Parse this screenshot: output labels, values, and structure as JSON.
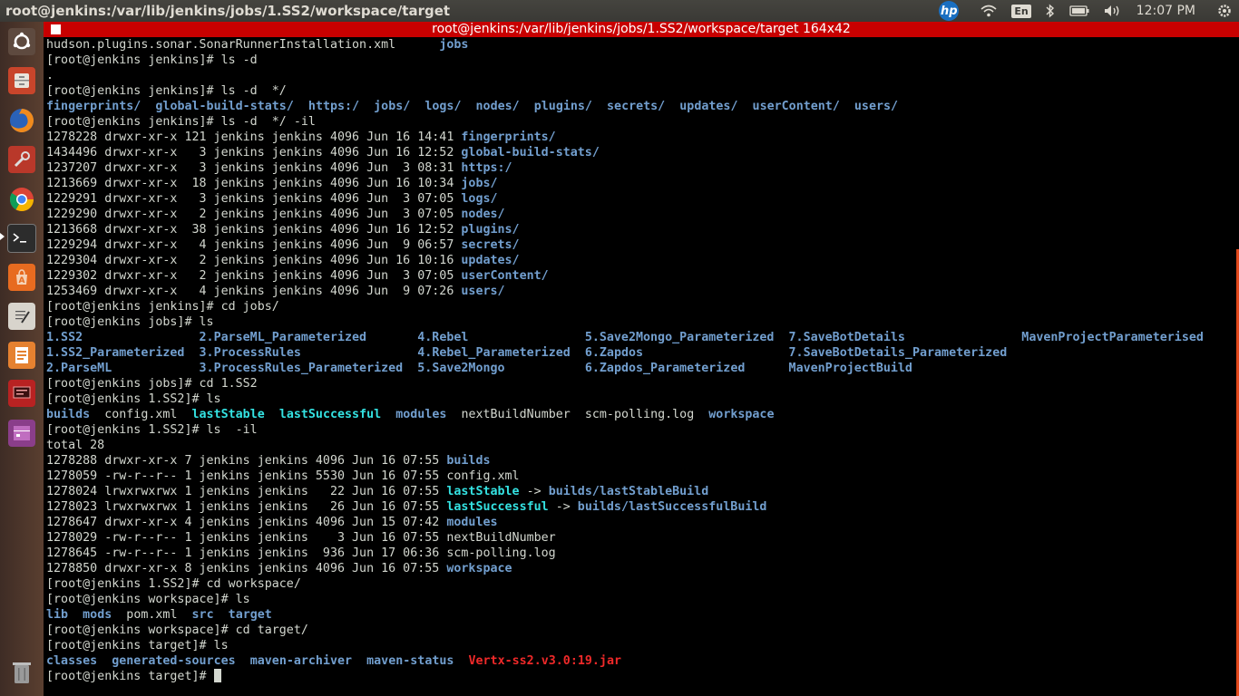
{
  "topbar": {
    "title": "root@jenkins:/var/lib/jenkins/jobs/1.SS2/workspace/target",
    "hp": "hp",
    "keyboard": "En",
    "clock": "12:07 PM"
  },
  "launcher": {
    "items": [
      "Dash Home",
      "Files",
      "Firefox",
      "System Settings",
      "Chrome",
      "Terminal",
      "Ubuntu Software Center",
      "Text Editor",
      "LibreOffice Impress",
      "Remote Desktop",
      "Workspace Switcher",
      "Trash"
    ]
  },
  "terminal": {
    "title": "root@jenkins:/var/lib/jenkins/jobs/1.SS2/workspace/target 164x42",
    "prompts": {
      "jenkins": "[root@jenkins jenkins]# ",
      "jobs": "[root@jenkins jobs]# ",
      "ss2": "[root@jenkins 1.SS2]# ",
      "workspace": "[root@jenkins workspace]# ",
      "target": "[root@jenkins target]# "
    },
    "lines": [
      {
        "segs": [
          {
            "t": "hudson.plugins.sonar.SonarRunnerInstallation.xml      ",
            "c": ""
          },
          {
            "t": "jobs",
            "c": "dir"
          }
        ]
      },
      {
        "segs": [
          {
            "t": "[root@jenkins jenkins]# ls -d",
            "c": ""
          }
        ]
      },
      {
        "segs": [
          {
            "t": ".",
            "c": ""
          }
        ]
      },
      {
        "segs": [
          {
            "t": "[root@jenkins jenkins]# ls -d  */",
            "c": ""
          }
        ]
      },
      {
        "segs": [
          {
            "t": "fingerprints/",
            "c": "dir"
          },
          {
            "t": "  ",
            "c": ""
          },
          {
            "t": "global-build-stats/",
            "c": "dir"
          },
          {
            "t": "  ",
            "c": ""
          },
          {
            "t": "https:/",
            "c": "dir"
          },
          {
            "t": "  ",
            "c": ""
          },
          {
            "t": "jobs/",
            "c": "dir"
          },
          {
            "t": "  ",
            "c": ""
          },
          {
            "t": "logs/",
            "c": "dir"
          },
          {
            "t": "  ",
            "c": ""
          },
          {
            "t": "nodes/",
            "c": "dir"
          },
          {
            "t": "  ",
            "c": ""
          },
          {
            "t": "plugins/",
            "c": "dir"
          },
          {
            "t": "  ",
            "c": ""
          },
          {
            "t": "secrets/",
            "c": "dir"
          },
          {
            "t": "  ",
            "c": ""
          },
          {
            "t": "updates/",
            "c": "dir"
          },
          {
            "t": "  ",
            "c": ""
          },
          {
            "t": "userContent/",
            "c": "dir"
          },
          {
            "t": "  ",
            "c": ""
          },
          {
            "t": "users/",
            "c": "dir"
          }
        ]
      },
      {
        "segs": [
          {
            "t": "[root@jenkins jenkins]# ls -d  */ -il",
            "c": ""
          }
        ]
      },
      {
        "segs": [
          {
            "t": "1278228 drwxr-xr-x 121 jenkins jenkins 4096 Jun 16 14:41 ",
            "c": ""
          },
          {
            "t": "fingerprints/",
            "c": "dir"
          }
        ]
      },
      {
        "segs": [
          {
            "t": "1434496 drwxr-xr-x   3 jenkins jenkins 4096 Jun 16 12:52 ",
            "c": ""
          },
          {
            "t": "global-build-stats/",
            "c": "dir"
          }
        ]
      },
      {
        "segs": [
          {
            "t": "1237207 drwxr-xr-x   3 jenkins jenkins 4096 Jun  3 08:31 ",
            "c": ""
          },
          {
            "t": "https:/",
            "c": "dir"
          }
        ]
      },
      {
        "segs": [
          {
            "t": "1213669 drwxr-xr-x  18 jenkins jenkins 4096 Jun 16 10:34 ",
            "c": ""
          },
          {
            "t": "jobs/",
            "c": "dir"
          }
        ]
      },
      {
        "segs": [
          {
            "t": "1229291 drwxr-xr-x   3 jenkins jenkins 4096 Jun  3 07:05 ",
            "c": ""
          },
          {
            "t": "logs/",
            "c": "dir"
          }
        ]
      },
      {
        "segs": [
          {
            "t": "1229290 drwxr-xr-x   2 jenkins jenkins 4096 Jun  3 07:05 ",
            "c": ""
          },
          {
            "t": "nodes/",
            "c": "dir"
          }
        ]
      },
      {
        "segs": [
          {
            "t": "1213668 drwxr-xr-x  38 jenkins jenkins 4096 Jun 16 12:52 ",
            "c": ""
          },
          {
            "t": "plugins/",
            "c": "dir"
          }
        ]
      },
      {
        "segs": [
          {
            "t": "1229294 drwxr-xr-x   4 jenkins jenkins 4096 Jun  9 06:57 ",
            "c": ""
          },
          {
            "t": "secrets/",
            "c": "dir"
          }
        ]
      },
      {
        "segs": [
          {
            "t": "1229304 drwxr-xr-x   2 jenkins jenkins 4096 Jun 16 10:16 ",
            "c": ""
          },
          {
            "t": "updates/",
            "c": "dir"
          }
        ]
      },
      {
        "segs": [
          {
            "t": "1229302 drwxr-xr-x   2 jenkins jenkins 4096 Jun  3 07:05 ",
            "c": ""
          },
          {
            "t": "userContent/",
            "c": "dir"
          }
        ]
      },
      {
        "segs": [
          {
            "t": "1253469 drwxr-xr-x   4 jenkins jenkins 4096 Jun  9 07:26 ",
            "c": ""
          },
          {
            "t": "users/",
            "c": "dir"
          }
        ]
      },
      {
        "segs": [
          {
            "t": "[root@jenkins jenkins]# cd jobs/",
            "c": ""
          }
        ]
      },
      {
        "segs": [
          {
            "t": "[root@jenkins jobs]# ls",
            "c": ""
          }
        ]
      },
      {
        "segs": [
          {
            "t": "1.SS2",
            "c": "dir"
          },
          {
            "t": "                ",
            "c": ""
          },
          {
            "t": "2.ParseML_Parameterized",
            "c": "dir"
          },
          {
            "t": "       ",
            "c": ""
          },
          {
            "t": "4.Rebel",
            "c": "dir"
          },
          {
            "t": "                ",
            "c": ""
          },
          {
            "t": "5.Save2Mongo_Parameterized",
            "c": "dir"
          },
          {
            "t": "  ",
            "c": ""
          },
          {
            "t": "7.SaveBotDetails",
            "c": "dir"
          },
          {
            "t": "                ",
            "c": ""
          },
          {
            "t": "MavenProjectParameterised",
            "c": "dir"
          }
        ]
      },
      {
        "segs": [
          {
            "t": "1.SS2_Parameterized",
            "c": "dir"
          },
          {
            "t": "  ",
            "c": ""
          },
          {
            "t": "3.ProcessRules",
            "c": "dir"
          },
          {
            "t": "                ",
            "c": ""
          },
          {
            "t": "4.Rebel_Parameterized",
            "c": "dir"
          },
          {
            "t": "  ",
            "c": ""
          },
          {
            "t": "6.Zapdos",
            "c": "dir"
          },
          {
            "t": "                    ",
            "c": ""
          },
          {
            "t": "7.SaveBotDetails_Parameterized",
            "c": "dir"
          }
        ]
      },
      {
        "segs": [
          {
            "t": "2.ParseML",
            "c": "dir"
          },
          {
            "t": "            ",
            "c": ""
          },
          {
            "t": "3.ProcessRules_Parameterized",
            "c": "dir"
          },
          {
            "t": "  ",
            "c": ""
          },
          {
            "t": "5.Save2Mongo",
            "c": "dir"
          },
          {
            "t": "           ",
            "c": ""
          },
          {
            "t": "6.Zapdos_Parameterized",
            "c": "dir"
          },
          {
            "t": "      ",
            "c": ""
          },
          {
            "t": "MavenProjectBuild",
            "c": "dir"
          }
        ]
      },
      {
        "segs": [
          {
            "t": "[root@jenkins jobs]# cd 1.SS2",
            "c": ""
          }
        ]
      },
      {
        "segs": [
          {
            "t": "[root@jenkins 1.SS2]# ls",
            "c": ""
          }
        ]
      },
      {
        "segs": [
          {
            "t": "builds",
            "c": "dir"
          },
          {
            "t": "  config.xml  ",
            "c": ""
          },
          {
            "t": "lastStable",
            "c": "link"
          },
          {
            "t": "  ",
            "c": ""
          },
          {
            "t": "lastSuccessful",
            "c": "link"
          },
          {
            "t": "  ",
            "c": ""
          },
          {
            "t": "modules",
            "c": "dir"
          },
          {
            "t": "  nextBuildNumber  scm-polling.log  ",
            "c": ""
          },
          {
            "t": "workspace",
            "c": "dir"
          }
        ]
      },
      {
        "segs": [
          {
            "t": "[root@jenkins 1.SS2]# ls  -il",
            "c": ""
          }
        ]
      },
      {
        "segs": [
          {
            "t": "total 28",
            "c": ""
          }
        ]
      },
      {
        "segs": [
          {
            "t": "1278288 drwxr-xr-x 7 jenkins jenkins 4096 Jun 16 07:55 ",
            "c": ""
          },
          {
            "t": "builds",
            "c": "dir"
          }
        ]
      },
      {
        "segs": [
          {
            "t": "1278059 -rw-r--r-- 1 jenkins jenkins 5530 Jun 16 07:55 config.xml",
            "c": ""
          }
        ]
      },
      {
        "segs": [
          {
            "t": "1278024 lrwxrwxrwx 1 jenkins jenkins   22 Jun 16 07:55 ",
            "c": ""
          },
          {
            "t": "lastStable",
            "c": "link"
          },
          {
            "t": " -> ",
            "c": ""
          },
          {
            "t": "builds/lastStableBuild",
            "c": "dir"
          }
        ]
      },
      {
        "segs": [
          {
            "t": "1278023 lrwxrwxrwx 1 jenkins jenkins   26 Jun 16 07:55 ",
            "c": ""
          },
          {
            "t": "lastSuccessful",
            "c": "link"
          },
          {
            "t": " -> ",
            "c": ""
          },
          {
            "t": "builds/lastSuccessfulBuild",
            "c": "dir"
          }
        ]
      },
      {
        "segs": [
          {
            "t": "1278647 drwxr-xr-x 4 jenkins jenkins 4096 Jun 15 07:42 ",
            "c": ""
          },
          {
            "t": "modules",
            "c": "dir"
          }
        ]
      },
      {
        "segs": [
          {
            "t": "1278029 -rw-r--r-- 1 jenkins jenkins    3 Jun 16 07:55 nextBuildNumber",
            "c": ""
          }
        ]
      },
      {
        "segs": [
          {
            "t": "1278645 -rw-r--r-- 1 jenkins jenkins  936 Jun 17 06:36 scm-polling.log",
            "c": ""
          }
        ]
      },
      {
        "segs": [
          {
            "t": "1278850 drwxr-xr-x 8 jenkins jenkins 4096 Jun 16 07:55 ",
            "c": ""
          },
          {
            "t": "workspace",
            "c": "dir"
          }
        ]
      },
      {
        "segs": [
          {
            "t": "[root@jenkins 1.SS2]# cd workspace/",
            "c": ""
          }
        ]
      },
      {
        "segs": [
          {
            "t": "[root@jenkins workspace]# ls",
            "c": ""
          }
        ]
      },
      {
        "segs": [
          {
            "t": "lib",
            "c": "dir"
          },
          {
            "t": "  ",
            "c": ""
          },
          {
            "t": "mods",
            "c": "dir"
          },
          {
            "t": "  pom.xml  ",
            "c": ""
          },
          {
            "t": "src",
            "c": "dir"
          },
          {
            "t": "  ",
            "c": ""
          },
          {
            "t": "target",
            "c": "dir"
          }
        ]
      },
      {
        "segs": [
          {
            "t": "[root@jenkins workspace]# cd target/",
            "c": ""
          }
        ]
      },
      {
        "segs": [
          {
            "t": "[root@jenkins target]# ls",
            "c": ""
          }
        ]
      },
      {
        "segs": [
          {
            "t": "classes",
            "c": "dir"
          },
          {
            "t": "  ",
            "c": ""
          },
          {
            "t": "generated-sources",
            "c": "dir"
          },
          {
            "t": "  ",
            "c": ""
          },
          {
            "t": "maven-archiver",
            "c": "dir"
          },
          {
            "t": "  ",
            "c": ""
          },
          {
            "t": "maven-status",
            "c": "dir"
          },
          {
            "t": "  ",
            "c": ""
          },
          {
            "t": "Vertx-ss2.v3.0:19.jar",
            "c": "red"
          }
        ]
      },
      {
        "segs": [
          {
            "t": "[root@jenkins target]# ",
            "c": ""
          }
        ],
        "cursor": true
      }
    ]
  },
  "colors": {
    "directory": "#729fcf",
    "symlink": "#34e2e2",
    "archive": "#ef2929",
    "terminal_titlebar": "#c80000"
  }
}
